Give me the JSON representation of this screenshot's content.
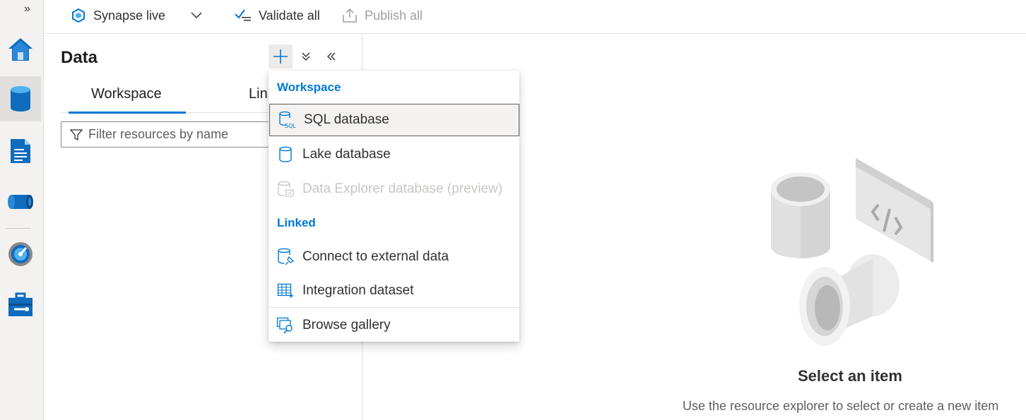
{
  "toolbar": {
    "workspace_mode": "Synapse live",
    "validate_label": "Validate all",
    "publish_label": "Publish all"
  },
  "rail": {
    "expand_icon": "double-chevron-right-icon",
    "items": [
      "home-icon",
      "data-icon",
      "develop-icon",
      "integrate-icon",
      "monitor-icon",
      "manage-icon"
    ],
    "active": "data-icon"
  },
  "panel": {
    "title": "Data",
    "tabs": [
      {
        "label": "Workspace",
        "selected": true
      },
      {
        "label": "Linked",
        "selected": false
      }
    ],
    "filter_placeholder": "Filter resources by name"
  },
  "menu": {
    "section_workspace": "Workspace",
    "section_linked": "Linked",
    "items": [
      {
        "label": "SQL database",
        "icon": "sql-database-icon",
        "selected": true
      },
      {
        "label": "Lake database",
        "icon": "lake-database-icon"
      },
      {
        "label": "Data Explorer database (preview)",
        "icon": "data-explorer-database-icon",
        "disabled": true
      },
      {
        "label": "Connect to external data",
        "icon": "connect-external-data-icon"
      },
      {
        "label": "Integration dataset",
        "icon": "integration-dataset-icon"
      },
      {
        "label": "Browse gallery",
        "icon": "browse-gallery-icon"
      }
    ]
  },
  "empty_state": {
    "title": "Select an item",
    "subtitle": "Use the resource explorer to select or create a new item"
  },
  "colors": {
    "accent": "#0078d4",
    "rail_bg": "#f3f2f1"
  }
}
